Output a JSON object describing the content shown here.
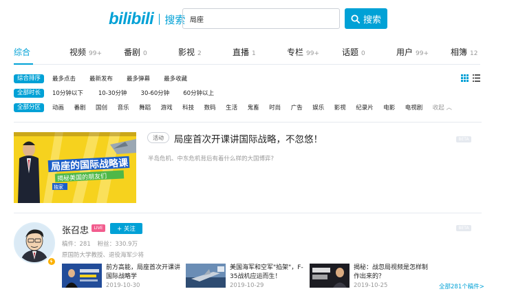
{
  "header": {
    "logo_text": "bilibili",
    "logo_sub": "搜索",
    "search_value": "局座",
    "search_button": "搜索"
  },
  "tabs": [
    {
      "label": "综合",
      "count": ""
    },
    {
      "label": "视频",
      "count": "99+"
    },
    {
      "label": "番剧",
      "count": "0"
    },
    {
      "label": "影视",
      "count": "2"
    },
    {
      "label": "直播",
      "count": "1"
    },
    {
      "label": "专栏",
      "count": "99+"
    },
    {
      "label": "话题",
      "count": "0"
    },
    {
      "label": "用户",
      "count": "99+"
    },
    {
      "label": "相簿",
      "count": "12"
    }
  ],
  "filters": {
    "order": {
      "chip": "综合排序",
      "options": [
        "最多点击",
        "最新发布",
        "最多弹幕",
        "最多收藏"
      ]
    },
    "duration": {
      "chip": "全部时长",
      "options": [
        "10分钟以下",
        "10-30分钟",
        "30-60分钟",
        "60分钟以上"
      ]
    },
    "zone": {
      "chip": "全部分区",
      "options": [
        "动画",
        "番剧",
        "国创",
        "音乐",
        "舞蹈",
        "游戏",
        "科技",
        "数码",
        "生活",
        "鬼畜",
        "时尚",
        "广告",
        "娱乐",
        "影视",
        "纪录片",
        "电影",
        "电视剧"
      ],
      "collapse": "收起"
    }
  },
  "activity": {
    "tag": "活动",
    "title": "局座首次开课讲国际战略，不忽悠！",
    "desc": "半岛危机、中东危机背后有着什么样的大国博弈?",
    "beta": "BETA",
    "banner_title": "局座的国际战略课",
    "banner_sub": "揭秘美国的朋友们",
    "banner_tag": "独家"
  },
  "user": {
    "name": "张召忠",
    "live": "LIVE",
    "follow": "+ 关注",
    "videos_label": "稿件：281",
    "fans_label": "粉丝：330.9万",
    "desc": "原国防大学教授、退役海军少将",
    "beta": "BETA",
    "all_link": "全部281个稿件>",
    "videos": [
      {
        "title": "前方高能，局座首次开课讲国际战略学",
        "date": "2019-10-30"
      },
      {
        "title": "美国海军和空军\"掐架\"，F-35战机应运而生！",
        "date": "2019-10-29"
      },
      {
        "title": "揭秘：战忽局视频是怎样制作出来的？",
        "date": "2019-10-25"
      }
    ]
  },
  "colors": {
    "accent": "#00a1d6",
    "live": "#f25d8e",
    "banner": "#f6d21e"
  }
}
